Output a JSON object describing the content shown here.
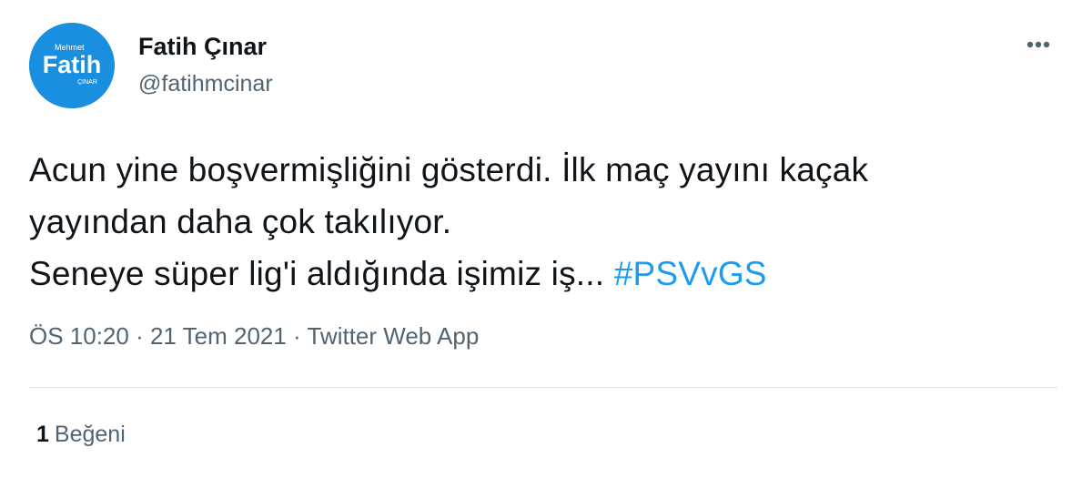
{
  "user": {
    "display_name": "Fatih Çınar",
    "handle": "@fatihmcinar",
    "avatar": {
      "top_text": "Mehmet",
      "main_text": "Fatih",
      "bottom_text": "ÇINAR",
      "color": "#1a8fe0"
    }
  },
  "more_icon": "more-horizontal-icon",
  "tweet": {
    "line1": "Acun yine boşvermişliğini gösterdi. İlk maç yayını kaçak",
    "line2": "yayından daha çok takılıyor.",
    "line3": "Seneye süper lig'i aldığında işimiz iş... ",
    "hashtag": "#PSVvGS",
    "hashtag_color": "#1d9bf0"
  },
  "meta": {
    "time": "ÖS 10:20",
    "sep1": " · ",
    "date": "21 Tem 2021",
    "sep2": " · ",
    "source": "Twitter Web App"
  },
  "stats": {
    "likes_count": "1",
    "likes_label": "Beğeni"
  }
}
